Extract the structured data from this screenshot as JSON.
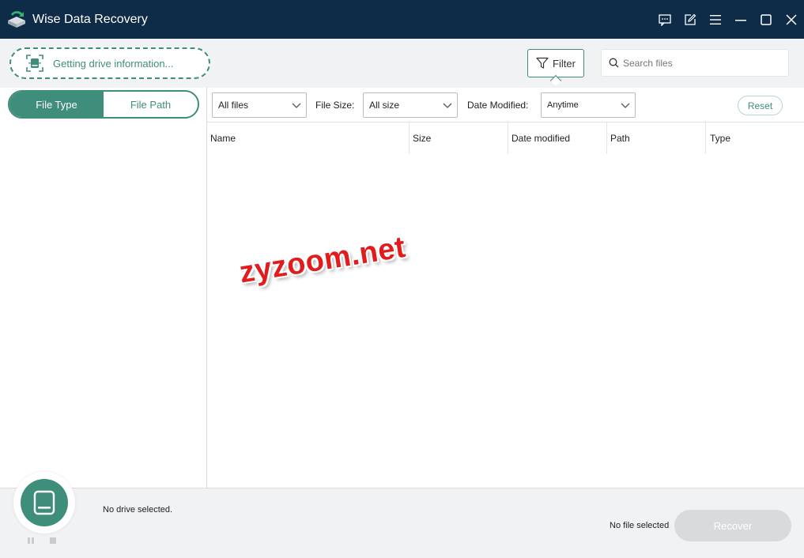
{
  "app": {
    "title": "Wise Data Recovery"
  },
  "colors": {
    "accent": "#3f8d7b",
    "titlebar": "#0e2b47",
    "disabled": "#d9dadb",
    "watermark": "#e21c1c"
  },
  "toolbar": {
    "drive_status": "Getting drive information...",
    "filter_label": "Filter",
    "search_placeholder": "Search files"
  },
  "left_panel": {
    "tabs": [
      {
        "label": "File Type",
        "active": true
      },
      {
        "label": "File Path",
        "active": false
      }
    ]
  },
  "filters": {
    "type_select": "All files",
    "size_label": "File Size:",
    "size_select": "All size",
    "date_label": "Date Modified:",
    "date_select": "Anytime",
    "reset_label": "Reset"
  },
  "table": {
    "columns": [
      "Name",
      "Size",
      "Date modified",
      "Path",
      "Type"
    ]
  },
  "bottom": {
    "drive_text": "No drive selected.",
    "file_text": "No file selected",
    "recover_label": "Recover"
  },
  "watermark": "zyzoom.net",
  "icons": [
    "app-logo-icon",
    "feedback-icon",
    "edit-icon",
    "menu-icon",
    "minimize-icon",
    "maximize-icon",
    "close-icon",
    "drive-scan-icon",
    "filter-icon",
    "search-icon",
    "chevron-down-icon",
    "drive-icon",
    "pause-icon",
    "stop-icon"
  ]
}
